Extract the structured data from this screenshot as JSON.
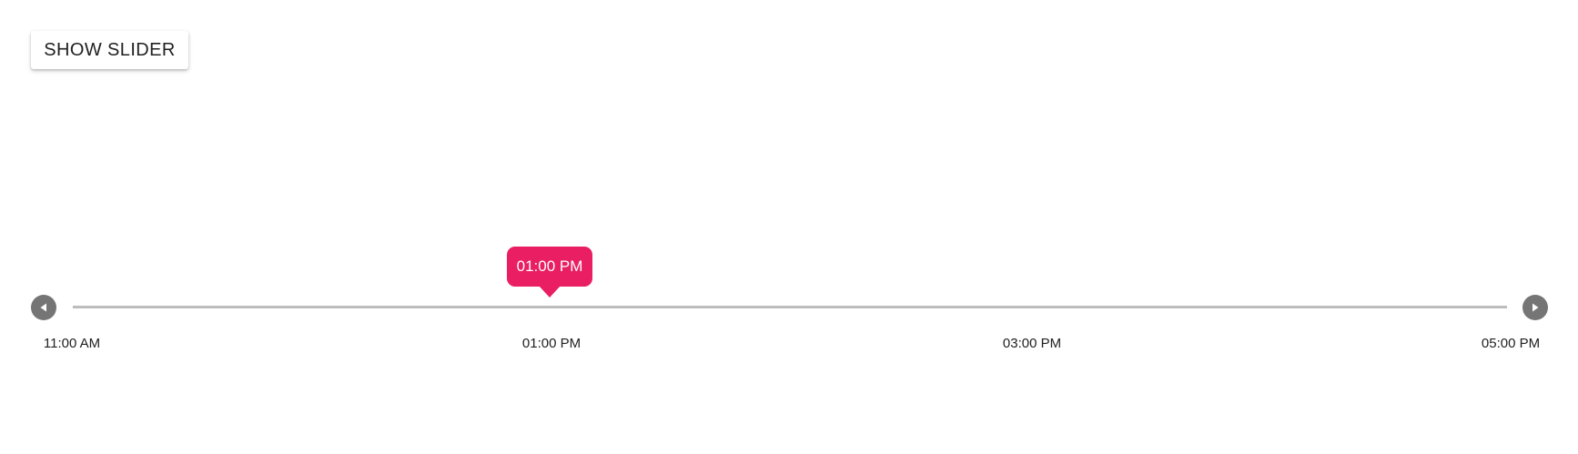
{
  "toolbar": {
    "show_slider_label": "SHOW SLIDER"
  },
  "slider": {
    "prev_icon": "play-left-icon",
    "next_icon": "play-right-icon",
    "accent_color": "#e91e63",
    "track_color": "#bdbdbd",
    "nav_color": "#757575",
    "current_value": "01:00 PM",
    "ticks": [
      {
        "label": "11:00 AM"
      },
      {
        "label": "01:00 PM"
      },
      {
        "label": "03:00 PM"
      },
      {
        "label": "05:00 PM"
      }
    ]
  }
}
